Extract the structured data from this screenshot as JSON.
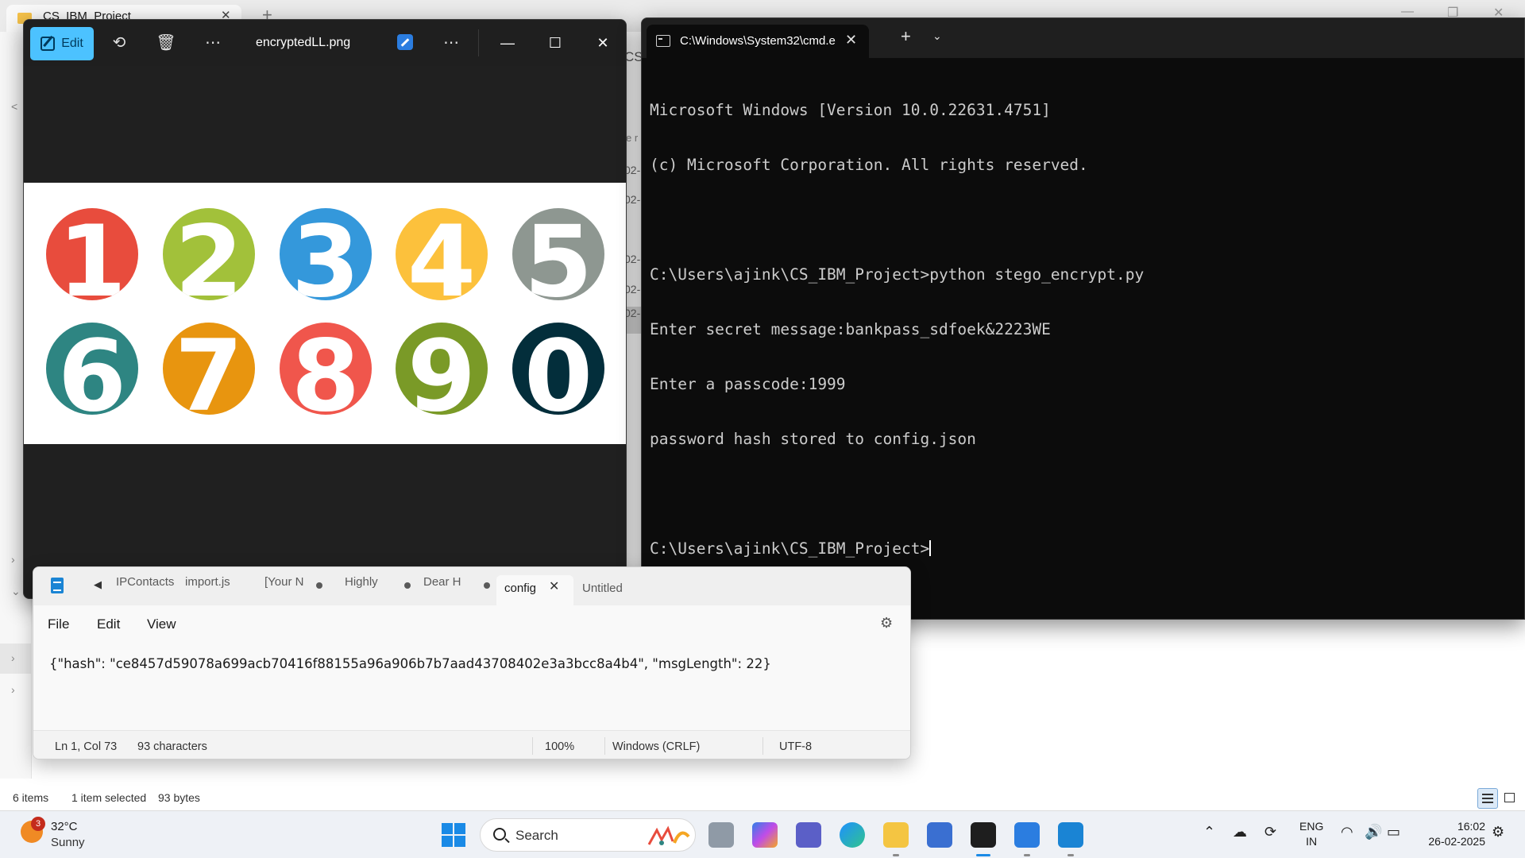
{
  "explorer": {
    "tab_label": "CS_IBM_Project",
    "status_items": "6 items",
    "status_selected": "1 item selected",
    "status_size": "93 bytes",
    "cs_fragment": "CS",
    "header_fragment": "e r",
    "date_fragments": [
      "02-",
      "02-",
      "02-",
      "02-",
      "02-"
    ]
  },
  "photos": {
    "edit_label": "Edit",
    "title": "encryptedLL.png",
    "circles": [
      {
        "digit": "1",
        "color": "#e84c3d"
      },
      {
        "digit": "2",
        "color": "#a2c13a"
      },
      {
        "digit": "3",
        "color": "#3498db"
      },
      {
        "digit": "4",
        "color": "#fcc13c"
      },
      {
        "digit": "5",
        "color": "#8e9791"
      },
      {
        "digit": "6",
        "color": "#2e8582"
      },
      {
        "digit": "7",
        "color": "#e8950f"
      },
      {
        "digit": "8",
        "color": "#f0564c"
      },
      {
        "digit": "9",
        "color": "#7a9a27"
      },
      {
        "digit": "0",
        "color": "#032e3b"
      }
    ]
  },
  "terminal": {
    "tab_label": "C:\\Windows\\System32\\cmd.e",
    "lines": [
      "Microsoft Windows [Version 10.0.22631.4751]",
      "(c) Microsoft Corporation. All rights reserved.",
      "",
      "C:\\Users\\ajink\\CS_IBM_Project>python stego_encrypt.py",
      "Enter secret message:bankpass_sdfoek&2223WE",
      "Enter a passcode:1999",
      "password hash stored to config.json",
      ""
    ],
    "prompt": "C:\\Users\\ajink\\CS_IBM_Project>"
  },
  "notepad": {
    "tabs": [
      {
        "label": "IPContacts",
        "modified": false,
        "active": false
      },
      {
        "label": "import.js",
        "modified": false,
        "active": false
      },
      {
        "label": "[Your N",
        "modified": true,
        "active": false
      },
      {
        "label": "Highly",
        "modified": true,
        "active": false
      },
      {
        "label": "Dear H",
        "modified": true,
        "active": false
      },
      {
        "label": "config",
        "modified": false,
        "active": true
      },
      {
        "label": "Untitled",
        "modified": false,
        "active": false
      }
    ],
    "menu": {
      "file": "File",
      "edit": "Edit",
      "view": "View"
    },
    "content": "{\"hash\": \"ce8457d59078a699acb70416f88155a96a906b7b7aad43708402e3a3bcc8a4b4\", \"msgLength\": 22}",
    "status": {
      "position": "Ln 1, Col 73",
      "characters": "93 characters",
      "zoom": "100%",
      "line_ending": "Windows (CRLF)",
      "encoding": "UTF-8"
    }
  },
  "taskbar": {
    "weather_badge": "3",
    "temperature": "32°C",
    "condition": "Sunny",
    "search_label": "Search",
    "lang_line1": "ENG",
    "lang_line2": "IN",
    "time": "16:02",
    "date": "26-02-2025"
  }
}
